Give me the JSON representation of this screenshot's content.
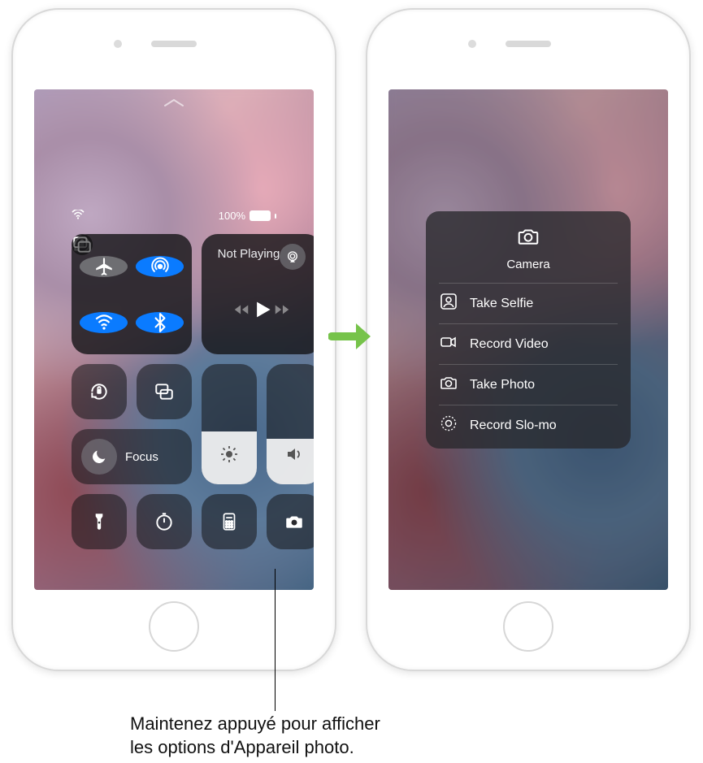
{
  "status": {
    "battery_pct": "100%"
  },
  "control_center": {
    "not_playing": "Not Playing",
    "focus": "Focus"
  },
  "camera_menu": {
    "title": "Camera",
    "items": [
      {
        "label": "Take Selfie"
      },
      {
        "label": "Record Video"
      },
      {
        "label": "Take Photo"
      },
      {
        "label": "Record Slo-mo"
      }
    ]
  },
  "callout": {
    "line1": "Maintenez appuyé pour afficher",
    "line2": "les options d'Appareil photo."
  }
}
